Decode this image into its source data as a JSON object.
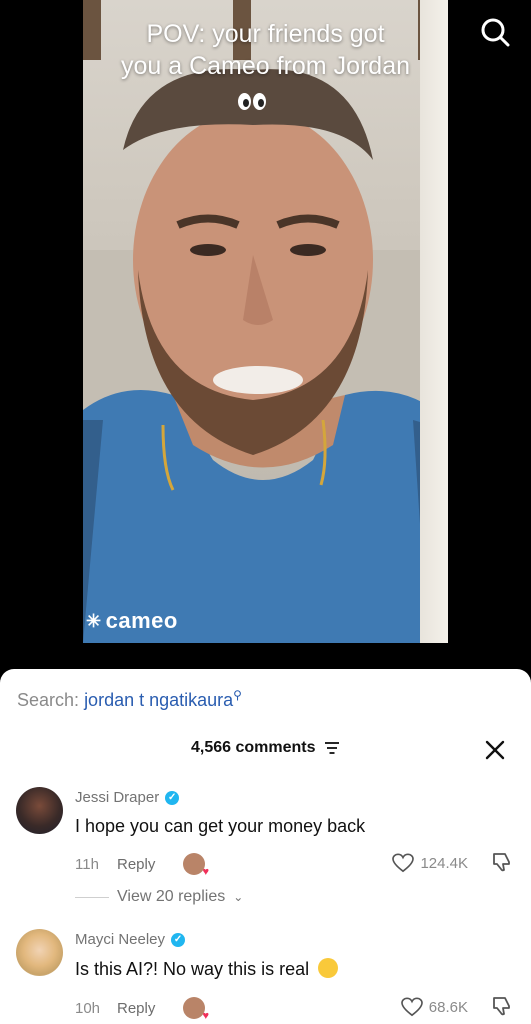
{
  "video": {
    "overlay_line1": "POV: your friends got",
    "overlay_line2": "you a Cameo from Jordan",
    "eyes_emoji": "👀",
    "watermark": "cameo",
    "search_icon": "search-icon"
  },
  "sheet": {
    "search_label": "Search:",
    "search_term": "jordan t ngatikaura",
    "comments_count": "4,566 comments",
    "close_icon": "close-icon"
  },
  "comments": [
    {
      "name": "Jessi Draper",
      "text": "I hope you can get your money back",
      "time": "11h",
      "reply_label": "Reply",
      "likes": "124.4K",
      "view_replies": "View 20 replies"
    },
    {
      "name": "Mayci Neeley",
      "text": "Is this AI?! No way this is real",
      "emoji": "😂",
      "time": "10h",
      "reply_label": "Reply",
      "likes": "68.6K"
    }
  ],
  "colors": {
    "link": "#2a5db0",
    "verified": "#20b6f0"
  }
}
